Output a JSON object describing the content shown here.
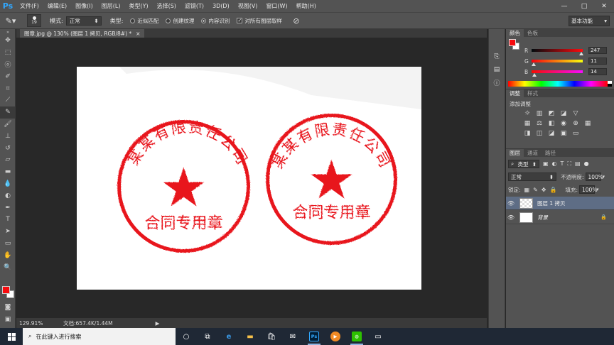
{
  "app": {
    "logo": "Ps"
  },
  "menu": [
    "文件(F)",
    "编辑(E)",
    "图像(I)",
    "图层(L)",
    "类型(Y)",
    "选择(S)",
    "滤镜(T)",
    "3D(D)",
    "视图(V)",
    "窗口(W)",
    "帮助(H)"
  ],
  "window_controls": [
    "—",
    "□",
    "✕"
  ],
  "options": {
    "brush_size": "19",
    "mode_label": "模式:",
    "mode_value": "正常",
    "type_label": "类型:",
    "radio_1": "近似匹配",
    "radio_2": "创建纹理",
    "radio_3": "内容识别",
    "check_label": "对所有图层取样",
    "workspace": "基本功能"
  },
  "document": {
    "tab_title": "图章.jpg @ 130% (图层 1 拷贝, RGB/8#) *",
    "tab_close": "×",
    "stamp_left": {
      "top_text": "某某有限责任公司",
      "bottom_text": "合同专用章"
    },
    "stamp_right": {
      "top_text": "某某有限责任公司",
      "bottom_text": "合同专用章"
    }
  },
  "status": {
    "zoom": "129.91%",
    "doc_info": "文档:657.4K/1.44M"
  },
  "panels": {
    "color_tabs": [
      "颜色",
      "色板"
    ],
    "rgb": [
      {
        "label": "R",
        "value": "247",
        "level": 0.969
      },
      {
        "label": "G",
        "value": "11",
        "level": 0.043
      },
      {
        "label": "B",
        "value": "14",
        "level": 0.055
      }
    ],
    "adjust_tabs": [
      "调整",
      "样式"
    ],
    "adjust_label": "添加调整",
    "layer_tabs": [
      "图层",
      "通道",
      "路径"
    ],
    "filter_kind": "类型",
    "blend_mode": "正常",
    "opacity_label": "不透明度:",
    "opacity_value": "100%",
    "lock_label": "锁定:",
    "fill_label": "填充:",
    "fill_value": "100%",
    "layers": [
      {
        "name": "图层 1 拷贝",
        "selected": true
      },
      {
        "name": "背景",
        "selected": false,
        "locked": true
      }
    ]
  },
  "taskbar": {
    "search_placeholder": "在此键入进行搜索"
  },
  "colors": {
    "stamp_red": "#e8121c",
    "foreground": "#f70b0e",
    "selection": "#5e6d85"
  }
}
